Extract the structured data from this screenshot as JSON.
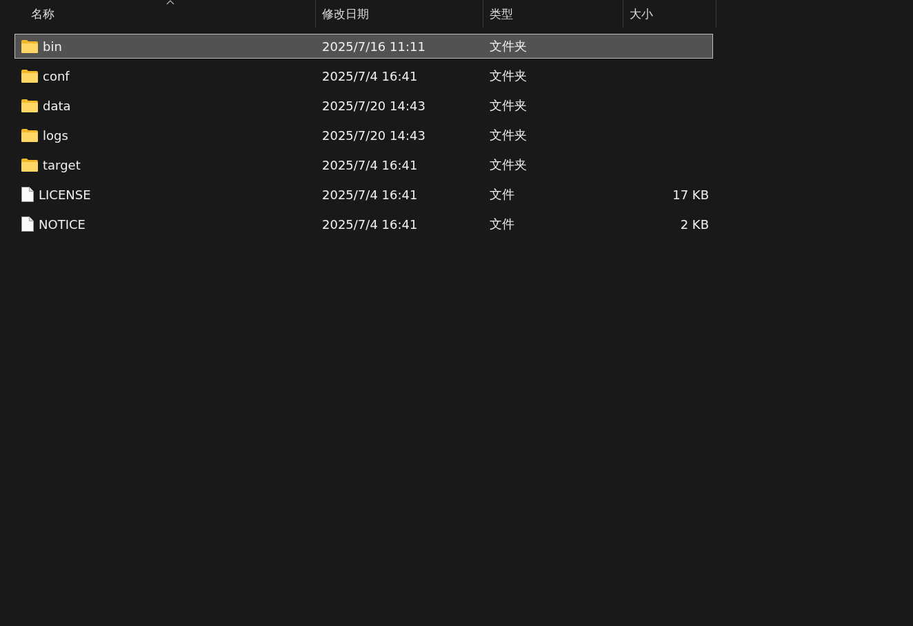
{
  "columns": [
    {
      "label": "名称",
      "sorted": true
    },
    {
      "label": "修改日期",
      "sorted": false
    },
    {
      "label": "类型",
      "sorted": false
    },
    {
      "label": "大小",
      "sorted": false
    }
  ],
  "rows": [
    {
      "kind": "folder",
      "name": "bin",
      "modified": "2025/7/16 11:11",
      "type": "文件夹",
      "selected": true
    },
    {
      "kind": "folder",
      "name": "conf",
      "modified": "2025/7/4 16:41",
      "type": "文件夹",
      "selected": false
    },
    {
      "kind": "folder",
      "name": "data",
      "modified": "2025/7/20 14:43",
      "type": "文件夹",
      "selected": false
    },
    {
      "kind": "folder",
      "name": "logs",
      "modified": "2025/7/20 14:43",
      "type": "文件夹",
      "selected": false
    },
    {
      "kind": "folder",
      "name": "target",
      "modified": "2025/7/4 16:41",
      "type": "文件夹",
      "selected": false
    },
    {
      "kind": "file",
      "name": "LICENSE",
      "modified": "2025/7/4 16:41",
      "type": "文件",
      "size": "17 KB",
      "selected": false
    },
    {
      "kind": "file",
      "name": "NOTICE",
      "modified": "2025/7/4 16:41",
      "type": "文件",
      "size": "2 KB",
      "selected": false
    }
  ]
}
